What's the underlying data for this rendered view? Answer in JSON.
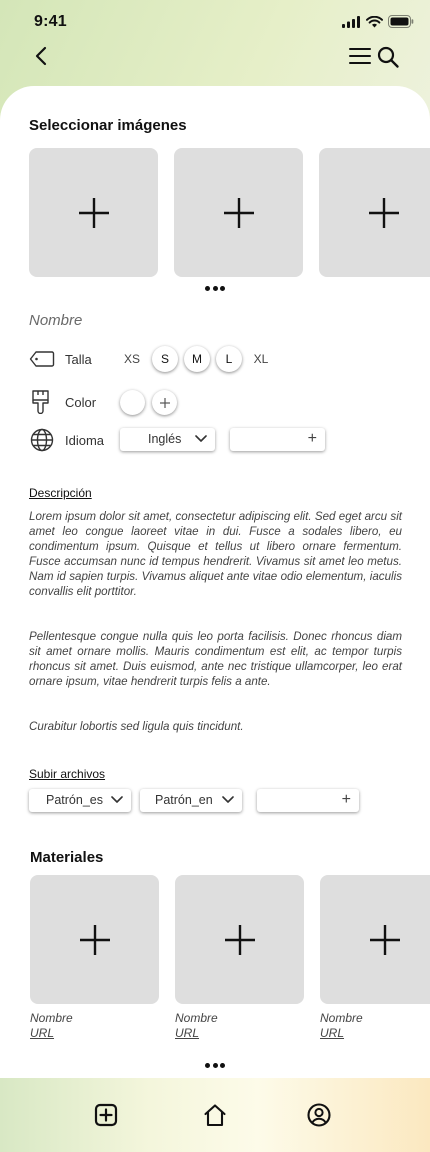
{
  "status": {
    "time": "9:41"
  },
  "images_section": {
    "title": "Seleccionar imágenes",
    "slots": 3
  },
  "product": {
    "name_placeholder": "Nombre",
    "size": {
      "label": "Talla",
      "options": [
        "XS",
        "S",
        "M",
        "L",
        "XL"
      ],
      "highlighted": [
        "S",
        "M",
        "L"
      ]
    },
    "color": {
      "label": "Color"
    },
    "language": {
      "label": "Idioma",
      "selected": "Inglés"
    }
  },
  "description": {
    "title": "Descripción",
    "paragraphs": [
      "Lorem ipsum dolor sit amet, consectetur adipiscing elit. Sed eget arcu sit amet leo congue laoreet vitae in dui. Fusce a sodales libero, eu condimentum ipsum. Quisque et tellus ut libero ornare fermentum. Fusce accumsan nunc id tempus hendrerit. Vivamus sit amet leo metus. Nam id sapien turpis. Vivamus aliquet ante vitae odio elementum, iaculis convallis elit porttitor.",
      "Pellentesque congue nulla quis leo porta facilisis. Donec rhoncus diam sit amet ornare mollis. Mauris condimentum est elit, ac tempor turpis rhoncus sit amet. Duis euismod, ante nec tristique ullamcorper, leo erat ornare ipsum, vitae hendrerit turpis felis a ante.",
      "Curabitur lobortis sed ligula quis tincidunt."
    ]
  },
  "files": {
    "title": "Subir archivos",
    "items": [
      "Patrón_es",
      "Patrón_en"
    ]
  },
  "materials": {
    "title": "Materiales",
    "items": [
      {
        "name": "Nombre",
        "url": "URL"
      },
      {
        "name": "Nombre",
        "url": "URL"
      },
      {
        "name": "Nombre",
        "url": "URL"
      }
    ]
  },
  "icons": {
    "back": "chevron-left-icon",
    "menu": "hamburger-icon",
    "search": "search-icon",
    "tag": "tag-icon",
    "brush": "paint-brush-icon",
    "globe": "globe-icon",
    "add_image": "plus-icon",
    "nav_add": "plus-square-icon",
    "nav_home": "home-icon",
    "nav_profile": "user-circle-icon"
  },
  "colors": {
    "placeholder_bg": "#dedede",
    "text": "#111111",
    "muted": "#444444"
  }
}
